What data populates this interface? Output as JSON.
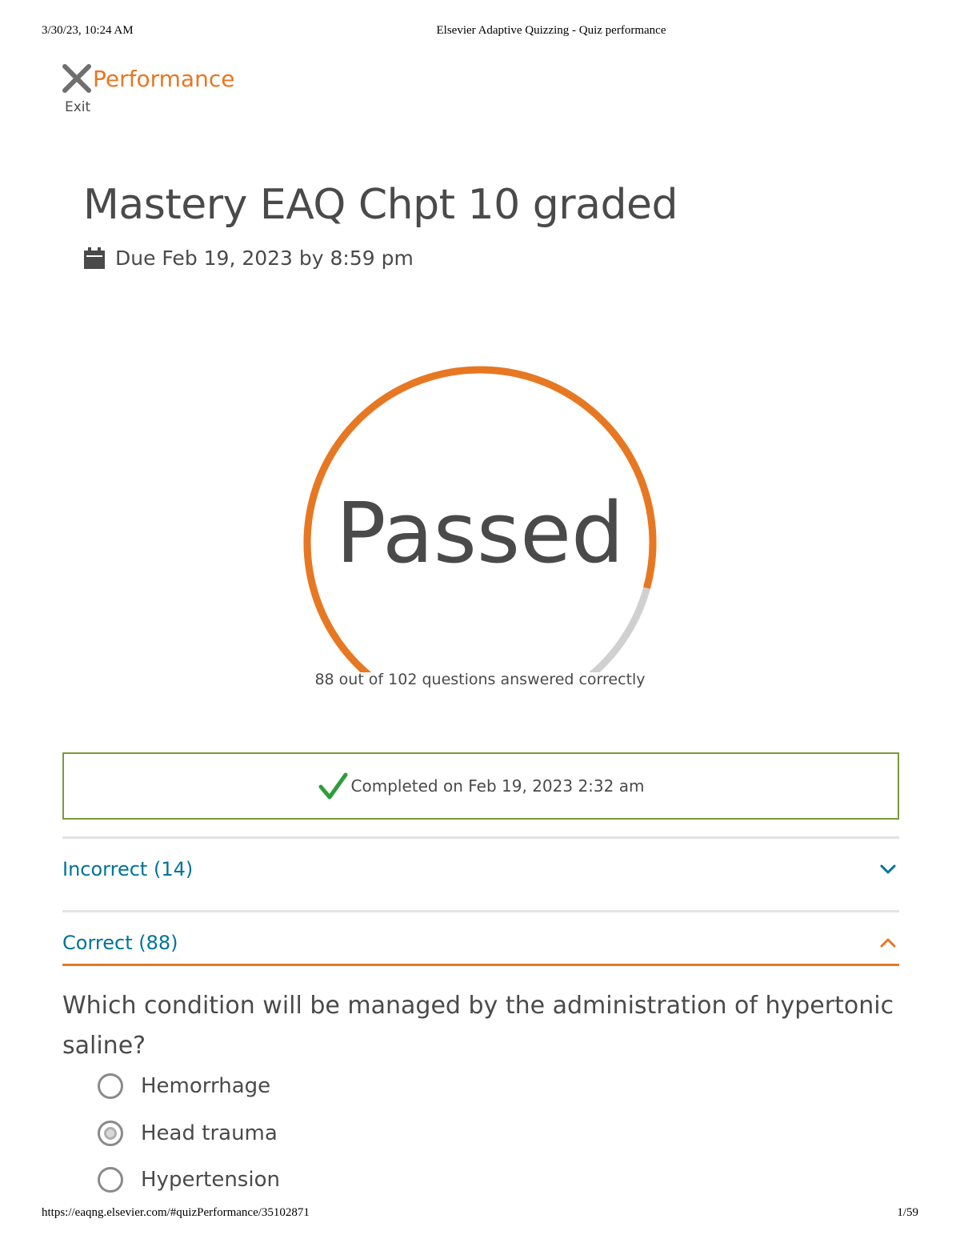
{
  "print_header": {
    "datetime": "3/30/23, 10:24 AM",
    "page_title": "Elsevier Adaptive Quizzing - Quiz performance"
  },
  "print_footer": {
    "url": "https://eaqng.elsevier.com/#quizPerformance/35102871",
    "page_number": "1/59"
  },
  "header": {
    "exit_label": "Exit",
    "title": "Performance"
  },
  "quiz": {
    "title": "Mastery EAQ Chpt 10 graded",
    "due": "Due Feb 19, 2023 by 8:59 pm"
  },
  "gauge": {
    "status": "Passed",
    "caption": "88 out of 102 questions answered correctly",
    "correct": 88,
    "total": 102
  },
  "completion": {
    "text": "Completed on Feb 19, 2023 2:32 am"
  },
  "sections": [
    {
      "label": "Incorrect (14)",
      "expanded": false
    },
    {
      "label": "Correct (88)",
      "expanded": true
    }
  ],
  "question": {
    "text": "Which condition will be managed by the administration of hypertonic saline?",
    "options": [
      {
        "label": "Hemorrhage",
        "selected": false
      },
      {
        "label": "Head trauma",
        "selected": true
      },
      {
        "label": "Hypertension",
        "selected": false
      }
    ]
  },
  "colors": {
    "accent": "#e87722",
    "link": "#007398",
    "track": "#d0d0d0",
    "success_border": "#7a9a3a",
    "check": "#2e9d3a"
  },
  "icons": {
    "exit": "close-icon",
    "due": "calendar-icon",
    "completed": "checkmark-icon",
    "incorrect_toggle": "chevron-down-icon",
    "correct_toggle": "chevron-up-icon"
  }
}
